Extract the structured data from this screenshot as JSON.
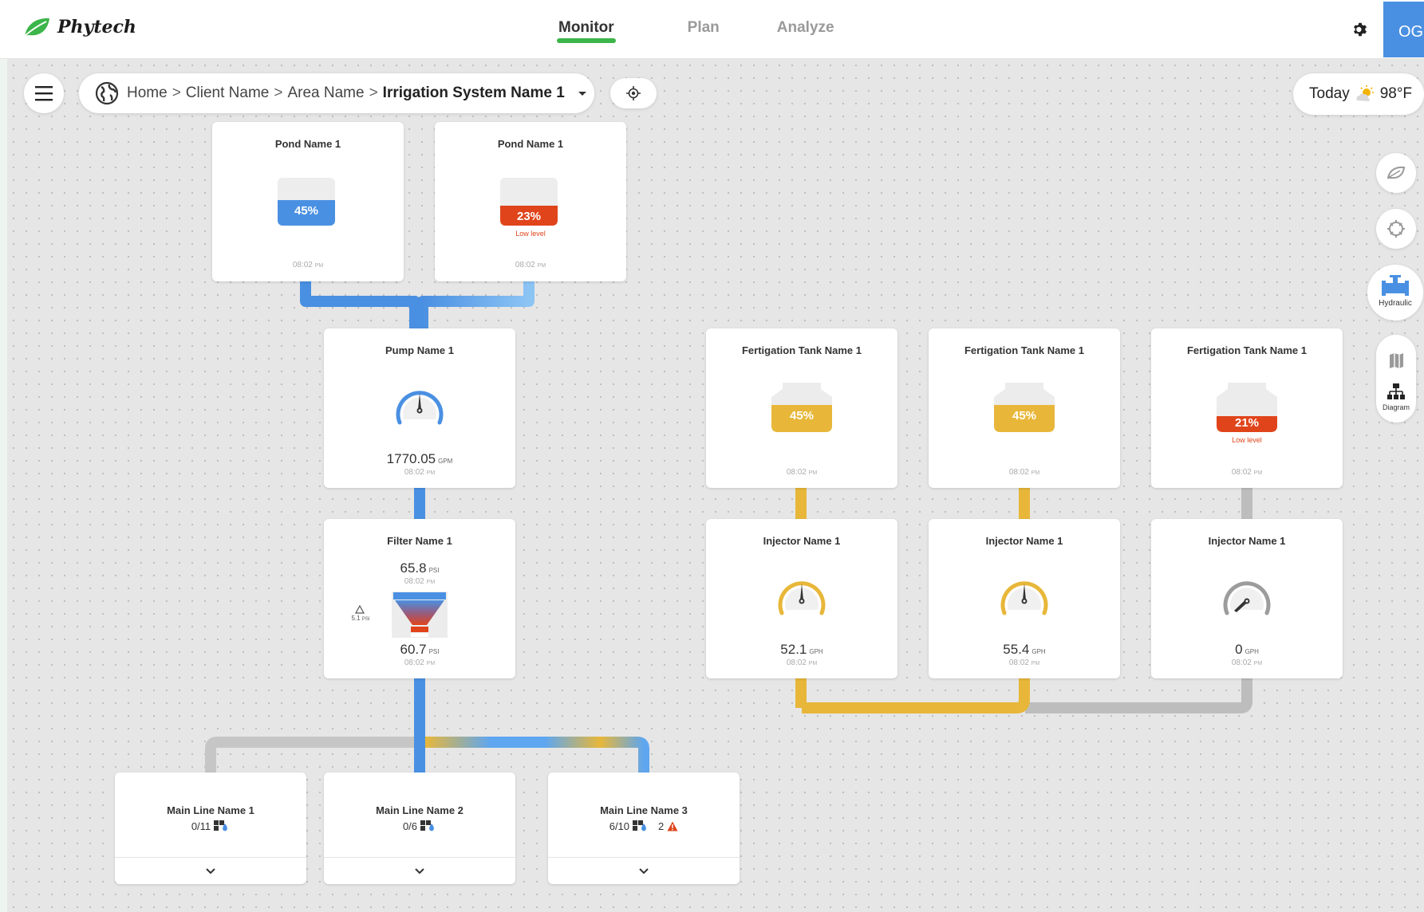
{
  "header": {
    "logo_text": "Phytech",
    "tabs": [
      {
        "label": "Monitor",
        "active": true
      },
      {
        "label": "Plan",
        "active": false
      },
      {
        "label": "Analyze",
        "active": false
      }
    ],
    "user_initials": "OG"
  },
  "breadcrumb": {
    "items": [
      "Home",
      "Client Name",
      "Area Name"
    ],
    "current": "Irrigation System Name 1"
  },
  "weather": {
    "label": "Today",
    "temp": "98°F"
  },
  "sidebar": {
    "hydraulic_label": "Hydraulic",
    "diagram_label": "Diagram"
  },
  "colors": {
    "water": "#4a90e2",
    "fert": "#e8b73a",
    "alert": "#e0441b",
    "idle": "#b8b8b8",
    "brand": "#3cb54a"
  },
  "ponds": [
    {
      "name": "Pond Name 1",
      "level": "45%",
      "level_value": 0.45,
      "status": "",
      "time": "08:02",
      "ampm": "PM"
    },
    {
      "name": "Pond Name 1",
      "level": "23%",
      "level_value": 0.23,
      "status": "Low level",
      "time": "08:02",
      "ampm": "PM"
    }
  ],
  "pump": {
    "name": "Pump Name 1",
    "value": "1770.05",
    "unit": "GPM",
    "time": "08:02",
    "ampm": "PM"
  },
  "filter": {
    "name": "Filter Name 1",
    "inlet": "65.8",
    "outlet": "60.7",
    "unit": "PSI",
    "delta": "5.1",
    "delta_unit": "PSI",
    "time": "08:02",
    "ampm": "PM"
  },
  "fert_tanks": [
    {
      "name": "Fertigation Tank Name 1",
      "level": "45%",
      "level_value": 0.45,
      "status": "",
      "time": "08:02",
      "ampm": "PM"
    },
    {
      "name": "Fertigation Tank Name 1",
      "level": "45%",
      "level_value": 0.45,
      "status": "",
      "time": "08:02",
      "ampm": "PM"
    },
    {
      "name": "Fertigation Tank Name 1",
      "level": "21%",
      "level_value": 0.21,
      "status": "Low level",
      "time": "08:02",
      "ampm": "PM"
    }
  ],
  "injectors": [
    {
      "name": "Injector Name 1",
      "value": "52.1",
      "unit": "GPH",
      "time": "08:02",
      "ampm": "PM"
    },
    {
      "name": "Injector Name 1",
      "value": "55.4",
      "unit": "GPH",
      "time": "08:02",
      "ampm": "PM"
    },
    {
      "name": "Injector Name 1",
      "value": "0",
      "unit": "GPH",
      "time": "08:02",
      "ampm": "PM"
    }
  ],
  "main_lines": [
    {
      "name": "Main Line Name 1",
      "count": "0/11",
      "alerts": ""
    },
    {
      "name": "Main Line Name 2",
      "count": "0/6",
      "alerts": ""
    },
    {
      "name": "Main Line Name 3",
      "count": "6/10",
      "alerts": "2"
    }
  ]
}
